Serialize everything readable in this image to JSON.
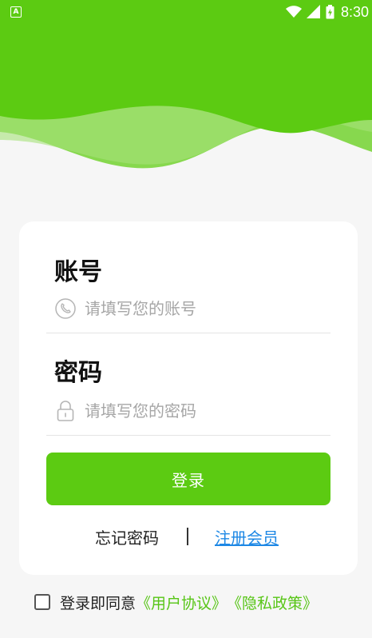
{
  "status_bar": {
    "left_icon_letter": "A",
    "time": "8:30",
    "icons": [
      "wifi-icon",
      "signal-icon",
      "battery-icon"
    ]
  },
  "colors": {
    "brand_green": "#5ccb12",
    "link_blue": "#1e88e5",
    "agreement_link_green": "#57c516"
  },
  "form": {
    "account_label": "账号",
    "account_placeholder": "请填写您的账号",
    "account_icon": "phone-icon",
    "password_label": "密码",
    "password_placeholder": "请填写您的密码",
    "password_icon": "lock-icon",
    "login_button": "登录",
    "forgot_password": "忘记密码",
    "register_member": "注册会员"
  },
  "agreement": {
    "prefix": "登录即同意",
    "user_agreement": "《用户协议》",
    "privacy_policy": "《隐私政策》",
    "checked": false
  }
}
